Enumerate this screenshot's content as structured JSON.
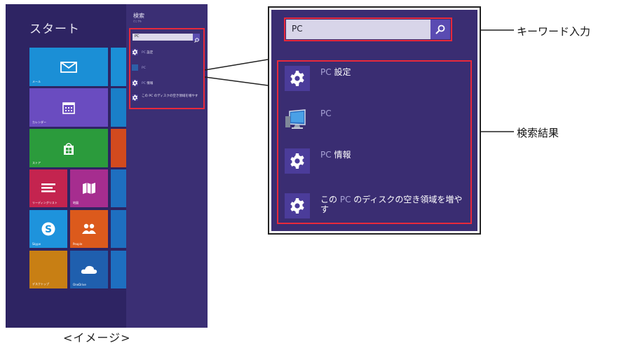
{
  "start": {
    "title": "スタート",
    "tiles": [
      {
        "label": "メール",
        "icon": "mail-icon",
        "color": "#1b8fd6"
      },
      {
        "label": "カレンダー",
        "icon": "calendar-icon",
        "color": "#6a4cc0"
      },
      {
        "label": "ストア",
        "icon": "store-icon",
        "color": "#2b9b3c"
      },
      {
        "label": "リーディングリスト",
        "icon": "reading-list-icon",
        "color": "#c4244f"
      },
      {
        "label": "地図",
        "icon": "maps-icon",
        "color": "#a62d8f"
      },
      {
        "label": "Skype",
        "icon": "skype-icon",
        "color": "#1e93dc"
      },
      {
        "label": "People",
        "icon": "people-icon",
        "color": "#dc5a1c"
      },
      {
        "label": "デスクトップ",
        "icon": "desktop-icon",
        "color": "#c87f14"
      },
      {
        "label": "OneDrive",
        "icon": "onedrive-icon",
        "color": "#1f5fae"
      }
    ]
  },
  "charm": {
    "title": "検索",
    "subtitle": "どこでも",
    "query": "PC",
    "results": [
      {
        "prefix": "PC",
        "rest": " 設定"
      },
      {
        "prefix": "PC",
        "rest": ""
      },
      {
        "prefix": "PC",
        "rest": " 情報"
      },
      {
        "prefix": "この PC のディスクの空き領域を増やす",
        "rest": ""
      }
    ]
  },
  "zoom": {
    "query": "PC",
    "results": [
      {
        "before": "",
        "hl": "PC",
        "after": " 設定",
        "icon": "gear-icon"
      },
      {
        "before": "",
        "hl": "PC",
        "after": "",
        "icon": "computer-icon"
      },
      {
        "before": "",
        "hl": "PC",
        "after": " 情報",
        "icon": "gear-icon"
      },
      {
        "before": "この ",
        "hl": "PC",
        "after": " のディスクの空き領域を増やす",
        "icon": "gear-icon"
      }
    ]
  },
  "callouts": {
    "keyword": "キーワード入力",
    "results": "検索結果"
  },
  "caption": "<イメージ>",
  "colors": {
    "accent_red": "#e8293b",
    "background": "#2e2463",
    "search_button": "#5a4bb2"
  }
}
